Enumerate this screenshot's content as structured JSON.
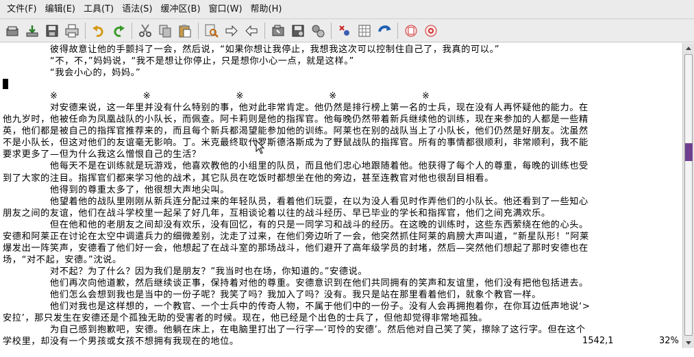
{
  "menu": [
    {
      "label": "文件(F)",
      "name": "menu-file"
    },
    {
      "label": "编辑(E)",
      "name": "menu-edit"
    },
    {
      "label": "工具(T)",
      "name": "menu-tools"
    },
    {
      "label": "语法(S)",
      "name": "menu-syntax"
    },
    {
      "label": "缓冲区(B)",
      "name": "menu-buffers"
    },
    {
      "label": "窗口(W)",
      "name": "menu-window"
    },
    {
      "label": "帮助(H)",
      "name": "menu-help"
    }
  ],
  "toolbar": [
    {
      "icon": "open-icon"
    },
    {
      "icon": "save-icon"
    },
    {
      "icon": "save-all-icon"
    },
    {
      "icon": "print-icon"
    },
    {
      "sep": true
    },
    {
      "icon": "undo-icon"
    },
    {
      "icon": "redo-icon"
    },
    {
      "sep": true
    },
    {
      "icon": "cut-icon"
    },
    {
      "icon": "copy-icon"
    },
    {
      "icon": "paste-icon"
    },
    {
      "sep": true
    },
    {
      "icon": "find-replace-icon"
    },
    {
      "icon": "find-next-icon"
    },
    {
      "icon": "find-prev-icon"
    },
    {
      "sep": true
    },
    {
      "icon": "load-session-icon"
    },
    {
      "icon": "save-session-icon"
    },
    {
      "icon": "run-script-icon"
    },
    {
      "sep": true
    },
    {
      "icon": "make-icon"
    },
    {
      "icon": "shell-icon"
    },
    {
      "icon": "run-ctags-icon"
    },
    {
      "sep": true
    },
    {
      "icon": "help-icon"
    },
    {
      "icon": "find-help-icon"
    }
  ],
  "editor": {
    "lines": [
      "　　　　　彼得故意让他的手颤抖了一会，然后说，“如果你想让我停止，我想我这次可以控制住自己了，我真的可以。”",
      "　　　　　“不，不，”妈妈说，“我不是想让你停止，只是想你小心一点，就是这样。”",
      "　　　　　“我会小心的，妈妈。”",
      "",
      "　　　　　※　　　　　　　　　※　　　　　　　　　※　　　　　　　　　※　　　　　　　　　※",
      "　　　　　对安德来说，这一年里并没有什么特别的事，他对此非常肯定。他仍然是排行榜上第一名的士兵，现在没有人再怀疑他的能力。在",
      "他九岁时，他被任命为凤凰战队的小队长，而佩查。阿卡莉则是他的指挥官。他每晚仍然带着新兵继续他的训练，现在来参加的人都是一些精",
      "英，他们都是被自己的指挥官推荐来的，而且每个新兵都渴望能参加他的训练。阿莱也在别的战队当上了小队长，他们仍然是好朋友。沈虽然",
      "不是小队长，但这对他们的友谊毫无影响。丁。米克最终取代罗斯德洛斯成为了野鼠战队的指挥官。所有的事情都很顺利，非常顺利，我不能",
      "要求更多了—但为什么我这么憎恨自己的生活？",
      "　　　　　他每天不是在训练就是玩游戏，他喜欢教他的小组里的队员，而且他们忠心地跟随着他。他获得了每个人的尊重，每晚的训练也受",
      "到了大家的注目。指挥官们都来学习他的战术，其它队员在吃饭时都想坐在他的旁边，甚至连教官对他也很刮目相看。",
      "　　　　　他得到的尊重太多了，他很想大声地尖叫。",
      "　　　　　他望着他的战队里刚刚从新兵连分配过来的年轻队员，看着他们玩耍，在以为没人看见时作弄他们的小队长。他还看到了一些知心",
      "朋友之间的友谊，他们在战斗学校里一起呆了好几年，互相谈论着以往的战斗经历、早已毕业的学长和指挥官，他们之间充满欢乐。",
      "　　　　　但在他和他的老朋友之间却没有欢乐，没有回忆，有的只是一同学习和战斗的经历。在这晚的训练时，这些东西萦绕在他的心头。",
      "安德和阿莱正在讨论在太空中调遣兵力的细微差别，沈走了过来，在他们旁边听了一会，他突然抓住阿莱的肩膀大声叫道，“新星队形！”阿莱",
      "爆发出一阵笑声，安德看了他们好一会，他想起了在战斗室的那场战斗，他们避开了高年级学员的封堵，然后—突然他们想起了那时安德也在",
      "场，“对不起，安德。”沈说。",
      "　　　　　对不起？为了什么？因为我们是朋友？”我当时也在场，你知道的。”安德说。",
      "　　　　　他们再次向他道歉，然后继续谈正事，保持着对他的尊重。安德意识到在他们共同拥有的笑声和友谊里，他们没有把他包括进去。",
      "　　　　　他们怎么会想到我也是当中的一份子呢？我笑了吗？我加入了吗？没有。我只是站在那里看着他们，就象个教官一样。",
      "　　　　　他们对我也是这样想的，一个教官、一个士兵中的传奇人物，不属于他们中的一份子。没有人会再拥抱着你，在你耳边低声地说‘>",
      "安拉’，那只发生在安德还是个孤独无助的受害者的时候。现在，他已经是个出色的士兵了，但他却觉得非常地孤独。",
      "　　　　　为自己感到抱歉吧，安德。他躺在床上，在电脑里打出了一行字—‘可怜的安德’。然后他对自己笑了笑，擦除了这行字。但在这个",
      "学校里，却没有一个男孩或女孩不想拥有我现在的地位。"
    ],
    "cursor_line": 3
  },
  "status": {
    "position": "1542,1",
    "percent": "32%"
  },
  "scroll_percent": 32,
  "colors": {
    "scroll_grip": "#6f3f8f"
  }
}
